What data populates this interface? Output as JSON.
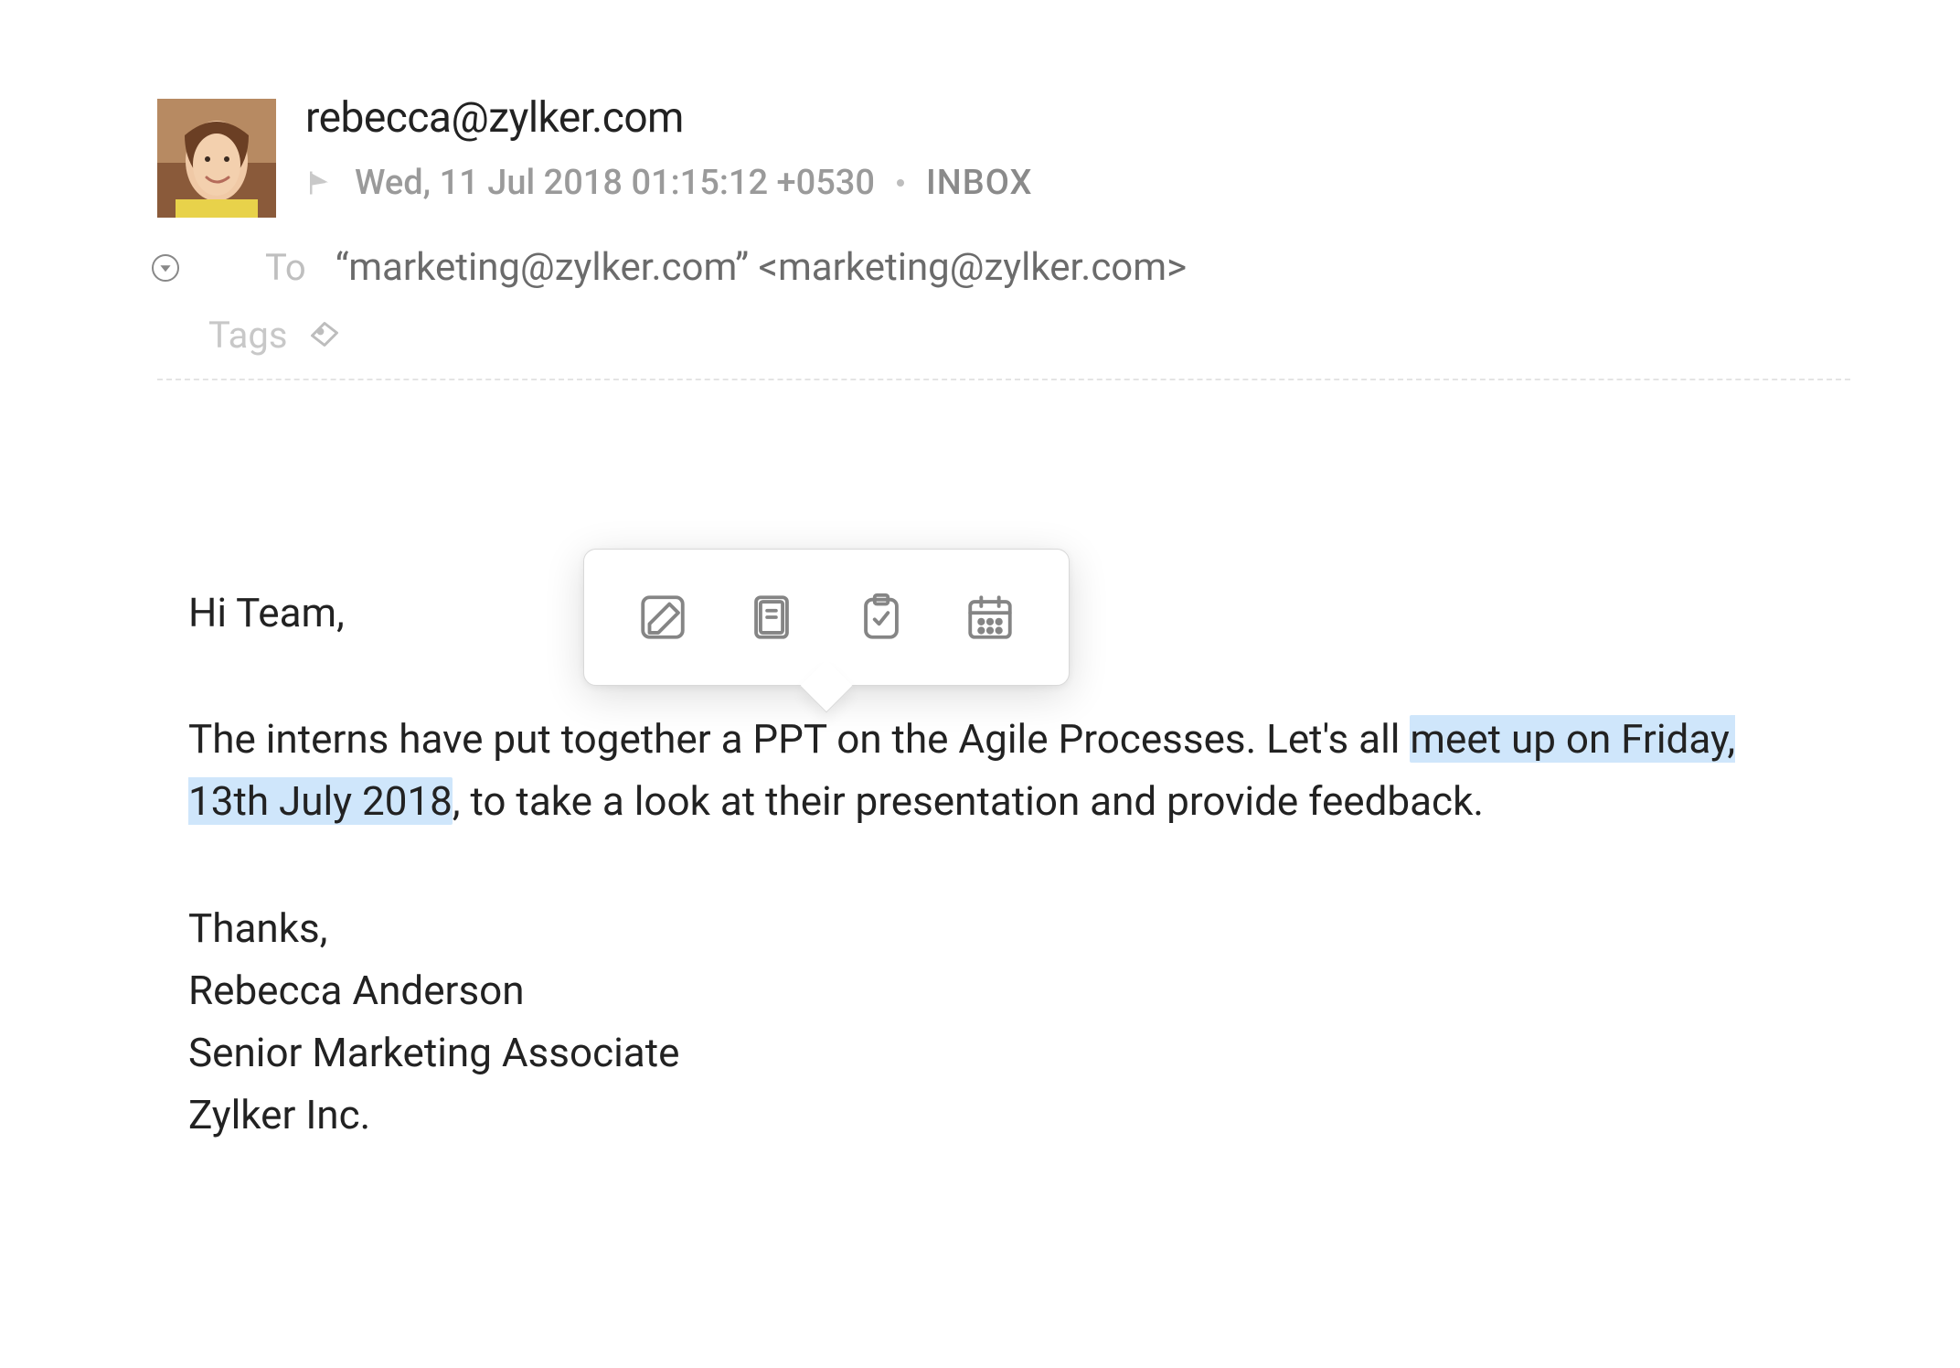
{
  "email": {
    "from": "rebecca@zylker.com",
    "date": "Wed, 11 Jul 2018 01:15:12 +0530",
    "folder": "INBOX",
    "to_label": "To",
    "to_value": "“marketing@zylker.com” <marketing@zylker.com>",
    "tags_label": "Tags"
  },
  "body": {
    "greeting": "Hi Team,",
    "para1_pre": "The interns have put together a PPT on the Agile Processes. Let's all ",
    "para1_highlight": "meet up on Friday, 13th July 2018",
    "para1_post": ", to take a look at their presentation and provide feedback.",
    "sig_thanks": "Thanks,",
    "sig_name": "Rebecca Anderson",
    "sig_title": "Senior Marketing Associate",
    "sig_company": "Zylker Inc."
  },
  "toolbar": {
    "edit": "compose-icon",
    "note": "note-icon",
    "task": "task-icon",
    "calendar": "calendar-icon"
  }
}
